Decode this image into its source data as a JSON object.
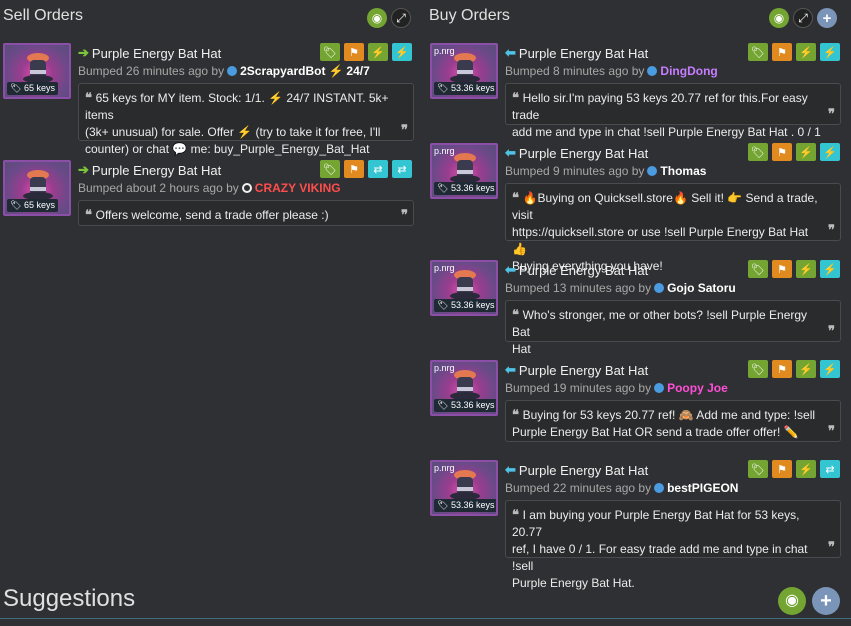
{
  "sell": {
    "title": "Sell Orders",
    "header_buttons": [
      "eye-icon",
      "expand-icon"
    ],
    "listings": [
      {
        "item": "Purple Energy Bat Hat",
        "price_tag": "65 keys",
        "bumped_prefix": "Bumped 26 minutes ago by",
        "user": "2ScrapyardBot",
        "user_suffix": "24/7",
        "user_color": "#ffffff",
        "message_lines": [
          "65 keys for MY item. Stock: 1/1. ⚡ 24/7 INSTANT. 5k+ items",
          "(3k+ unusual) for sale. Offer ⚡ (try to take it for free, I'll",
          "counter) or chat 💬 me: buy_Purple_Energy_Bat_Hat"
        ],
        "badges": [
          "green",
          "orange",
          "green",
          "cyan"
        ]
      },
      {
        "item": "Purple Energy Bat Hat",
        "price_tag": "65 keys",
        "bumped_prefix": "Bumped about 2 hours ago by",
        "user": "CRAZY VIKING",
        "user_suffix": "",
        "user_color": "#ff4d4d",
        "message_lines": [
          "Offers welcome, send a trade offer please :)"
        ],
        "badges": [
          "green",
          "orange",
          "cyan",
          "cyan"
        ]
      }
    ]
  },
  "buy": {
    "title": "Buy Orders",
    "header_buttons": [
      "eye-icon",
      "expand-icon",
      "plus-icon"
    ],
    "listings": [
      {
        "item": "Purple Energy Bat Hat",
        "price_tag": "53.36 keys",
        "img_label": "p.nrg",
        "bumped_prefix": "Bumped 8 minutes ago by",
        "user": "DingDong",
        "user_color": "#c77dff",
        "message_lines": [
          "Hello sir.I'm paying 53 keys 20.77 ref for this.For easy trade",
          "add me and type in chat !sell Purple Energy Bat Hat . 0 / 1"
        ],
        "badges": [
          "green",
          "orange",
          "green",
          "cyan"
        ]
      },
      {
        "item": "Purple Energy Bat Hat",
        "price_tag": "53.36 keys",
        "img_label": "p.nrg",
        "bumped_prefix": "Bumped 9 minutes ago by",
        "user": "Thomas",
        "user_color": "#ffffff",
        "message_lines": [
          "🔥Buying on Quicksell.store🔥 Sell it! 👉 Send a trade, visit",
          "https://quicksell.store or use !sell Purple Energy Bat Hat 👍",
          "Buying everything you have!"
        ],
        "badges": [
          "green",
          "orange",
          "green",
          "cyan"
        ]
      },
      {
        "item": "Purple Energy Bat Hat",
        "price_tag": "53.36 keys",
        "img_label": "p.nrg",
        "bumped_prefix": "Bumped 13 minutes ago by",
        "user": "Gojo Satoru",
        "user_color": "#ffffff",
        "message_lines": [
          "Who's stronger, me or other bots? !sell Purple Energy Bat",
          "Hat"
        ],
        "badges": [
          "green",
          "orange",
          "green",
          "cyan"
        ]
      },
      {
        "item": "Purple Energy Bat Hat",
        "price_tag": "53.36 keys",
        "img_label": "p.nrg",
        "bumped_prefix": "Bumped 19 minutes ago by",
        "user": "Poopy Joe",
        "user_color": "#ff4fd8",
        "message_lines": [
          "Buying for 53 keys 20.77 ref! 🙈 Add me and type: !sell",
          "Purple Energy Bat Hat OR send a trade offer offer! ✏️"
        ],
        "badges": [
          "green",
          "orange",
          "green",
          "cyan"
        ]
      },
      {
        "item": "Purple Energy Bat Hat",
        "price_tag": "53.36 keys",
        "img_label": "p.nrg",
        "bumped_prefix": "Bumped 22 minutes ago by",
        "user": "bestPIGEON",
        "user_color": "#ffffff",
        "message_lines": [
          "I am buying your Purple Energy Bat Hat for 53 keys, 20.77",
          "ref, I have 0 / 1. For easy trade add me and type in chat !sell",
          "Purple Energy Bat Hat."
        ],
        "badges": [
          "green",
          "orange",
          "green",
          "cyan"
        ]
      }
    ]
  },
  "suggestions": {
    "title": "Suggestions"
  }
}
